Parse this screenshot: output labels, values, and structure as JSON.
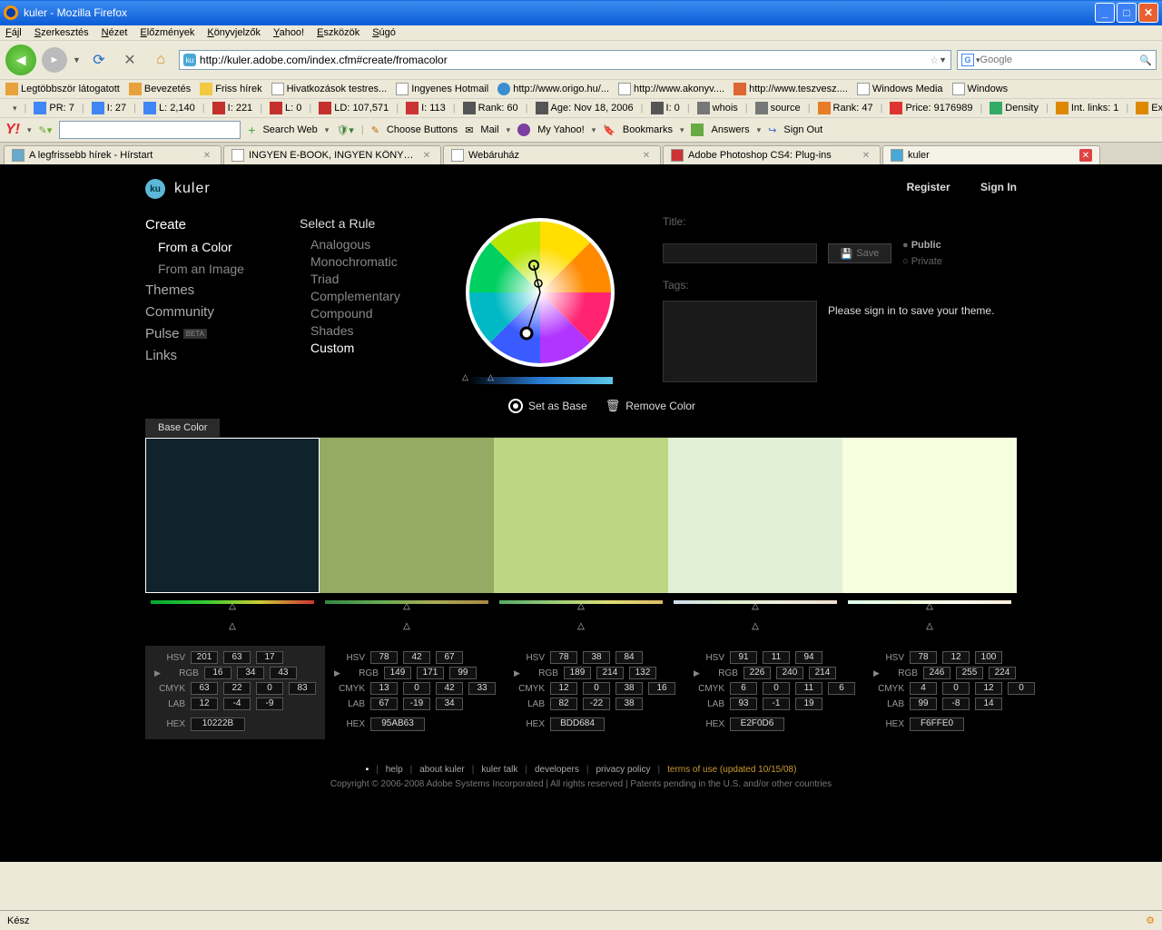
{
  "window": {
    "title": "kuler - Mozilla Firefox"
  },
  "menu": [
    "Fájl",
    "Szerkesztés",
    "Nézet",
    "Előzmények",
    "Könyvjelzők",
    "Yahoo!",
    "Eszközök",
    "Súgó"
  ],
  "url": "http://kuler.adobe.com/index.cfm#create/fromacolor",
  "search_placeholder": "Google",
  "bookmarks": [
    {
      "label": "Legtöbbször látogatott",
      "icon": "i-orange"
    },
    {
      "label": "Bevezetés",
      "icon": "i-orange"
    },
    {
      "label": "Friss hírek",
      "icon": "i-folder"
    },
    {
      "label": "Hivatkozások testres...",
      "icon": "i-page"
    },
    {
      "label": "Ingyenes Hotmail",
      "icon": "i-page"
    },
    {
      "label": "http://www.origo.hu/...",
      "icon": "i-globe"
    },
    {
      "label": "http://www.akonyv....",
      "icon": "i-page"
    },
    {
      "label": "http://www.teszvesz....",
      "icon": "i-red"
    },
    {
      "label": "Windows Media",
      "icon": "i-page"
    },
    {
      "label": "Windows",
      "icon": "i-page"
    }
  ],
  "seo": [
    "PR: 7",
    "I: 27",
    "L: 2,140",
    "I: 221",
    "L: 0",
    "LD: 107,571",
    "I: 113",
    "Rank: 60",
    "Age: Nov 18, 2006",
    "I: 0",
    "whois",
    "source",
    "Rank: 47",
    "Price: 9176989",
    "Density",
    "Int. links: 1",
    "Ext. links:"
  ],
  "yahoo": {
    "search": "Search Web",
    "choose": "Choose Buttons",
    "mail": "Mail",
    "my": "My Yahoo!",
    "bookmarks": "Bookmarks",
    "answers": "Answers",
    "signout": "Sign Out"
  },
  "tabs": [
    {
      "label": "A legfrissebb hírek - Hírstart",
      "active": false,
      "icon": "#6ac"
    },
    {
      "label": "INGYEN E-BOOK, INGYEN KÖNYV, SZA...",
      "active": false,
      "icon": "#fff"
    },
    {
      "label": "Webáruház",
      "active": false,
      "icon": "#fff"
    },
    {
      "label": "Adobe Photoshop CS4: Plug-ins",
      "active": false,
      "icon": "#c33"
    },
    {
      "label": "kuler",
      "active": true,
      "icon": "#4aa8d8"
    }
  ],
  "kuler": {
    "brand": "kuler",
    "topnav": {
      "register": "Register",
      "signin": "Sign In"
    },
    "leftnav": [
      {
        "label": "Create",
        "cls": "lvl1 active1"
      },
      {
        "label": "From a Color",
        "cls": "lvl2 active2"
      },
      {
        "label": "From an Image",
        "cls": "lvl2"
      },
      {
        "label": "Themes",
        "cls": "lvl1"
      },
      {
        "label": "Community",
        "cls": "lvl1"
      },
      {
        "label": "Pulse",
        "cls": "lvl1",
        "beta": "BETA"
      },
      {
        "label": "Links",
        "cls": "lvl1"
      }
    ],
    "rule": {
      "title": "Select a Rule",
      "items": [
        "Analogous",
        "Monochromatic",
        "Triad",
        "Complementary",
        "Compound",
        "Shades",
        "Custom"
      ],
      "active": "Custom"
    },
    "right": {
      "title": "Title:",
      "tags": "Tags:",
      "save": "Save",
      "public": "Public",
      "private": "Private",
      "msg": "Please sign in to save your theme."
    },
    "basecolor": "Base Color",
    "actions": {
      "setbase": "Set as Base",
      "remove": "Remove Color"
    },
    "swatches": [
      "#10222B",
      "#95AB63",
      "#BDD684",
      "#E2F0D6",
      "#F6FFE0"
    ],
    "selected": 0,
    "labels": {
      "hsv": "HSV",
      "rgb": "RGB",
      "cmyk": "CMYK",
      "lab": "LAB",
      "hex": "HEX"
    },
    "values": [
      {
        "hsv": [
          "201",
          "63",
          "17"
        ],
        "rgb": [
          "16",
          "34",
          "43"
        ],
        "cmyk": [
          "63",
          "22",
          "0",
          "83"
        ],
        "lab": [
          "12",
          "-4",
          "-9"
        ],
        "hex": "10222B"
      },
      {
        "hsv": [
          "78",
          "42",
          "67"
        ],
        "rgb": [
          "149",
          "171",
          "99"
        ],
        "cmyk": [
          "13",
          "0",
          "42",
          "33"
        ],
        "lab": [
          "67",
          "-19",
          "34"
        ],
        "hex": "95AB63"
      },
      {
        "hsv": [
          "78",
          "38",
          "84"
        ],
        "rgb": [
          "189",
          "214",
          "132"
        ],
        "cmyk": [
          "12",
          "0",
          "38",
          "16"
        ],
        "lab": [
          "82",
          "-22",
          "38"
        ],
        "hex": "BDD684"
      },
      {
        "hsv": [
          "91",
          "11",
          "94"
        ],
        "rgb": [
          "226",
          "240",
          "214"
        ],
        "cmyk": [
          "6",
          "0",
          "11",
          "6"
        ],
        "lab": [
          "93",
          "-1",
          "19"
        ],
        "hex": "E2F0D6"
      },
      {
        "hsv": [
          "78",
          "12",
          "100"
        ],
        "rgb": [
          "246",
          "255",
          "224"
        ],
        "cmyk": [
          "4",
          "0",
          "12",
          "0"
        ],
        "lab": [
          "99",
          "-8",
          "14"
        ],
        "hex": "F6FFE0"
      }
    ],
    "footer": {
      "links": [
        "help",
        "about kuler",
        "kuler talk",
        "developers",
        "privacy policy"
      ],
      "terms": "terms of use (updated 10/15/08)",
      "copy": "Copyright © 2006-2008 Adobe Systems Incorporated | All rights reserved | Patents pending in the U.S. and/or other countries"
    }
  },
  "status": "Kész"
}
